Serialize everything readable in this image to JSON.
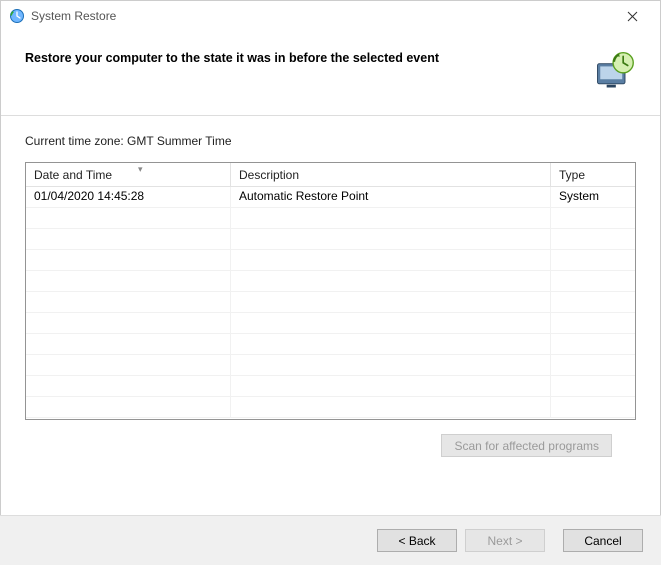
{
  "window": {
    "title": "System Restore"
  },
  "header": {
    "heading": "Restore your computer to the state it was in before the selected event"
  },
  "content": {
    "timezone_label": "Current time zone: GMT Summer Time",
    "columns": {
      "datetime": "Date and Time",
      "description": "Description",
      "type": "Type"
    },
    "rows": [
      {
        "datetime": "01/04/2020 14:45:28",
        "description": "Automatic Restore Point",
        "type": "System"
      }
    ],
    "scan_btn": "Scan for affected programs"
  },
  "footer": {
    "back": "< Back",
    "next": "Next >",
    "cancel": "Cancel"
  }
}
